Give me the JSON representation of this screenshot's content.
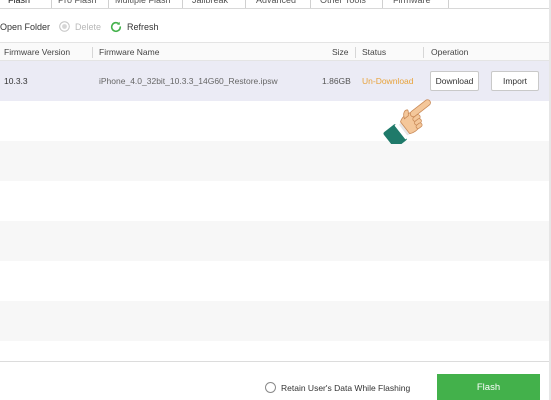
{
  "tabs": [
    {
      "label": "Flash",
      "active": true
    },
    {
      "label": "Pro Flash"
    },
    {
      "label": "Multiple Flash"
    },
    {
      "label": "Jailbreak"
    },
    {
      "label": "Advanced"
    },
    {
      "label": "Other Tools"
    },
    {
      "label": "Firmware"
    }
  ],
  "toolbar": {
    "open_folder_label": "Open Folder",
    "delete_label": "Delete",
    "refresh_label": "Refresh"
  },
  "table": {
    "columns": [
      "Firmware Version",
      "Firmware Name",
      "Size",
      "Status",
      "Operation"
    ],
    "rows": [
      {
        "version": "10.3.3",
        "name": "iPhone_4.0_32bit_10.3.3_14G60_Restore.ipsw",
        "size": "1.86GB",
        "status": "Un-Download",
        "download_label": "Download",
        "import_label": "Import"
      }
    ]
  },
  "footer": {
    "retain_label": "Retain User's Data While Flashing",
    "retain_checked": false,
    "flash_label": "Flash"
  },
  "colors": {
    "status_undownload": "#e8a33c",
    "accent_green": "#43b14b",
    "selected_row": "#ebebf5",
    "refresh_icon": "#43b14b"
  },
  "icons": {
    "open_folder": "folder-icon",
    "delete": "delete-icon",
    "refresh": "refresh-icon",
    "pointer": "hand-pointer-icon"
  }
}
